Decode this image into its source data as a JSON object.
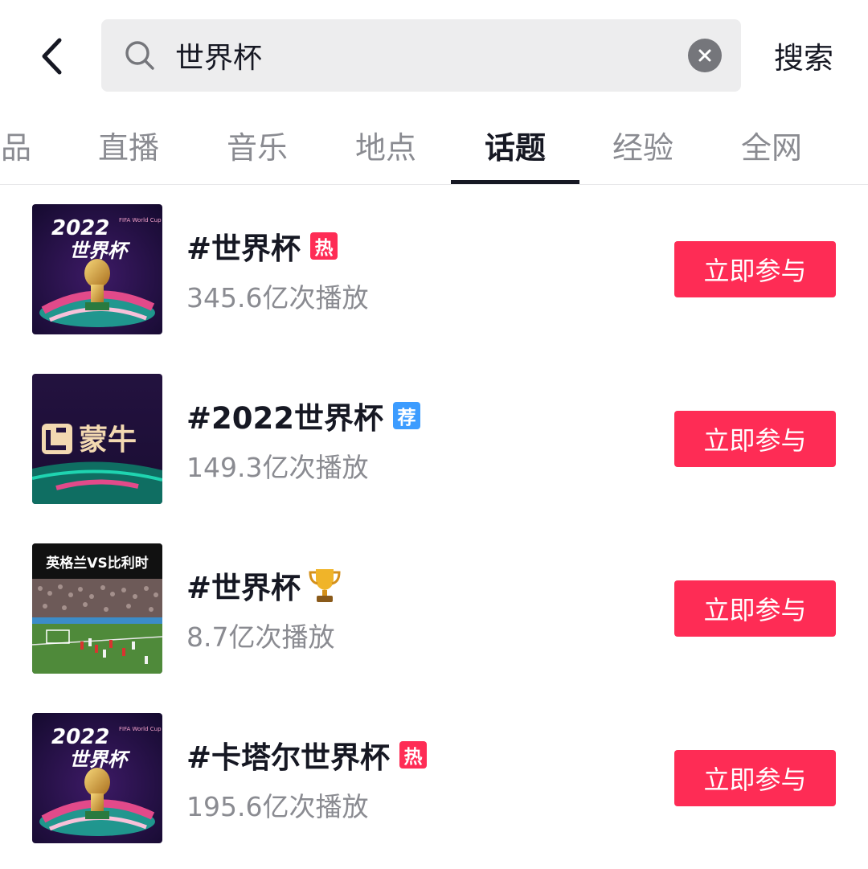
{
  "header": {
    "back_icon": "chevron-left-icon",
    "search": {
      "icon": "search-icon",
      "value": "世界杯",
      "clear_icon": "close-circle-icon"
    },
    "search_button_label": "搜索"
  },
  "tabs": [
    {
      "label": "品",
      "active": false
    },
    {
      "label": "直播",
      "active": false
    },
    {
      "label": "音乐",
      "active": false
    },
    {
      "label": "地点",
      "active": false
    },
    {
      "label": "话题",
      "active": true
    },
    {
      "label": "经验",
      "active": false
    },
    {
      "label": "全网",
      "active": false
    }
  ],
  "results": [
    {
      "title": "#世界杯",
      "badge": "热",
      "badge_type": "hot",
      "plays": "345.6亿次播放",
      "button_label": "立即参与",
      "thumbnail": {
        "type": "world-cup-poster",
        "year": "2022",
        "text": "世界杯",
        "logo_text": "FIFA World Cup"
      }
    },
    {
      "title": "#2022世界杯",
      "badge": "荐",
      "badge_type": "recommend",
      "plays": "149.3亿次播放",
      "button_label": "立即参与",
      "thumbnail": {
        "type": "sponsor-logo",
        "text": "蒙牛"
      }
    },
    {
      "title": "#世界杯",
      "badge_icon": "trophy-icon",
      "plays": "8.7亿次播放",
      "button_label": "立即参与",
      "thumbnail": {
        "type": "match-photo",
        "caption": "英格兰VS比利时"
      }
    },
    {
      "title": "#卡塔尔世界杯",
      "badge": "热",
      "badge_type": "hot",
      "plays": "195.6亿次播放",
      "button_label": "立即参与",
      "thumbnail": {
        "type": "world-cup-poster",
        "year": "2022",
        "text": "世界杯",
        "logo_text": "FIFA World Cup"
      }
    }
  ],
  "colors": {
    "accent": "#fe2c55",
    "recommend_badge": "#3c9cff",
    "search_bg": "#ededee",
    "secondary_text": "#8a8b91",
    "primary_text": "#161823"
  }
}
